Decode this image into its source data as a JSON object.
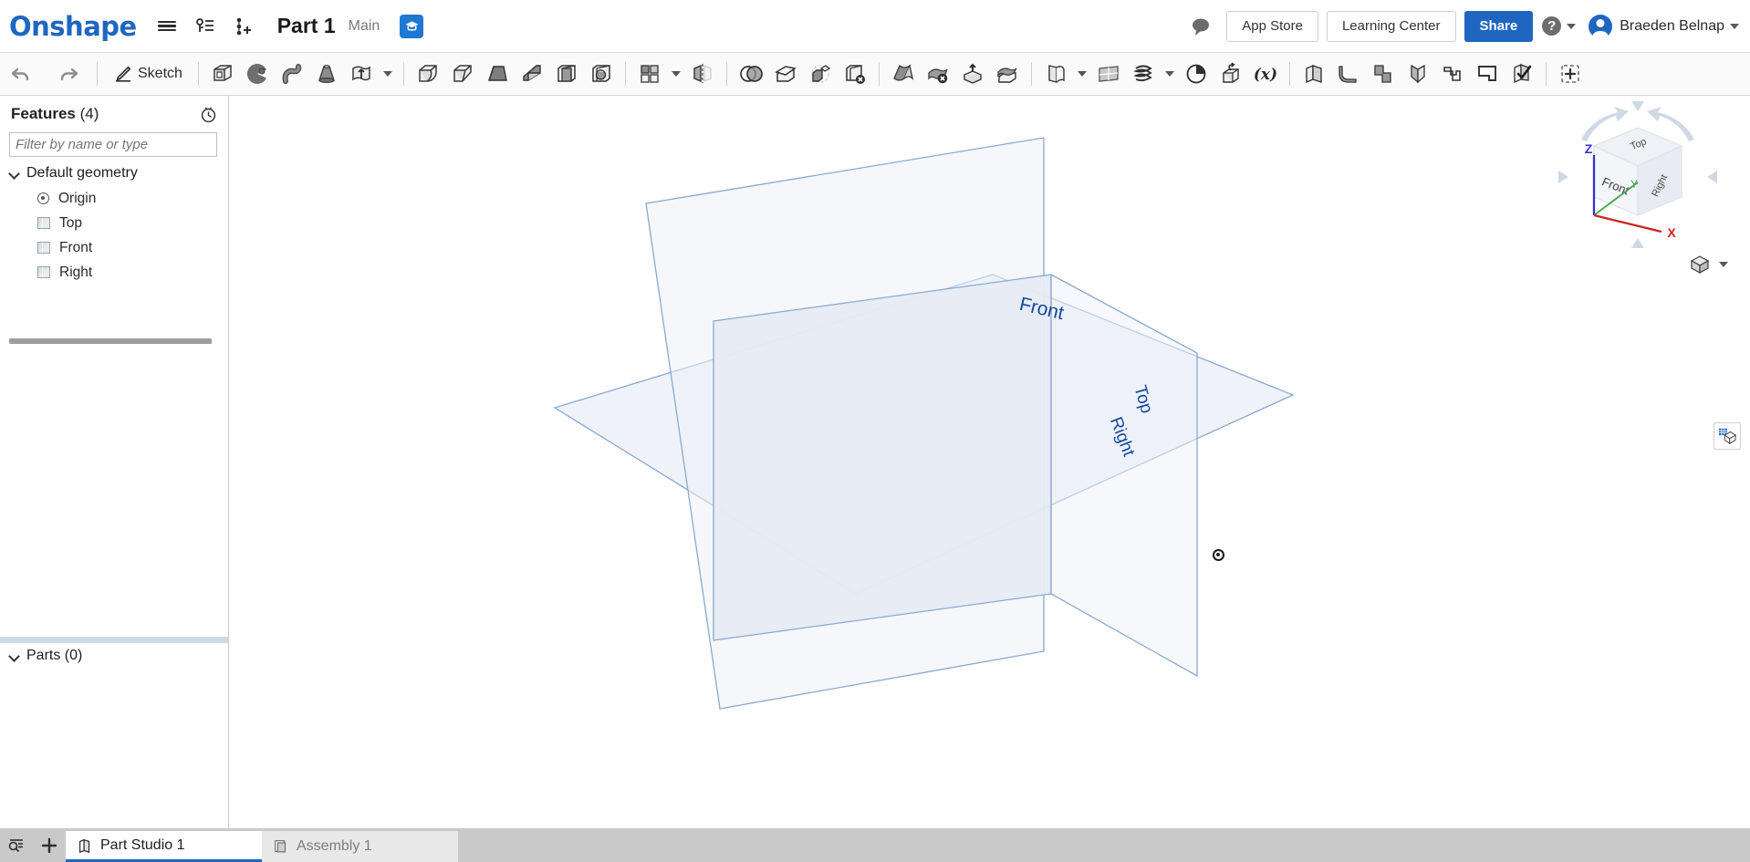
{
  "app": {
    "name": "Onshape",
    "brand_color": "#1f66c1"
  },
  "header": {
    "logo_text": "Onshape",
    "menu_icon": "hamburger-menu-icon",
    "versions_icon": "version-graph-icon",
    "insert_icon": "add-version-icon",
    "document_title": "Part 1",
    "branch": "Main",
    "workspace_badge_icon": "graduation-cap-icon",
    "comment_icon": "comment-bubble-icon",
    "app_store_label": "App Store",
    "learning_center_label": "Learning Center",
    "share_label": "Share",
    "help_label": "?",
    "user_name": "Braeden Belnap"
  },
  "toolbar": {
    "undo_icon": "undo-arrow-icon",
    "redo_icon": "redo-arrow-icon",
    "sketch_label": "Sketch",
    "sketch_icon": "sketch-pencil-icon",
    "items": [
      {
        "name": "extrude",
        "icon": "extrude-icon"
      },
      {
        "name": "revolve",
        "icon": "revolve-icon"
      },
      {
        "name": "sweep",
        "icon": "sweep-icon"
      },
      {
        "name": "loft",
        "icon": "loft-icon"
      },
      {
        "name": "thicken",
        "icon": "thicken-icon"
      },
      {
        "name": "fillet",
        "icon": "fillet-icon"
      },
      {
        "name": "chamfer",
        "icon": "chamfer-icon"
      },
      {
        "name": "draft",
        "icon": "draft-icon"
      },
      {
        "name": "rib",
        "icon": "rib-icon"
      },
      {
        "name": "shell",
        "icon": "shell-icon"
      },
      {
        "name": "hole",
        "icon": "hole-icon"
      },
      {
        "name": "linear-pattern",
        "icon": "pattern-grid-icon"
      },
      {
        "name": "mirror",
        "icon": "mirror-icon"
      },
      {
        "name": "boolean",
        "icon": "boolean-union-icon"
      },
      {
        "name": "split",
        "icon": "split-icon"
      },
      {
        "name": "transform",
        "icon": "transform-icon"
      },
      {
        "name": "delete-part",
        "icon": "delete-part-icon"
      },
      {
        "name": "sheet-metal-flange",
        "icon": "sheet-metal-flange-icon"
      },
      {
        "name": "delete-face",
        "icon": "delete-face-icon"
      },
      {
        "name": "move-face",
        "icon": "move-face-icon"
      },
      {
        "name": "replace-face",
        "icon": "replace-face-icon"
      },
      {
        "name": "plane",
        "icon": "construction-plane-icon"
      },
      {
        "name": "sketch-plane",
        "icon": "plane-grid-icon"
      },
      {
        "name": "helix",
        "icon": "helix-icon"
      },
      {
        "name": "mate-connector",
        "icon": "mate-connector-icon"
      },
      {
        "name": "derived",
        "icon": "derived-part-icon"
      },
      {
        "name": "variable",
        "icon": "variable-x-icon"
      },
      {
        "name": "sheet-metal-model",
        "icon": "sheet-metal-model-icon"
      },
      {
        "name": "sm-bend",
        "icon": "sm-bend-icon"
      },
      {
        "name": "sm-tab",
        "icon": "sm-tab-icon"
      },
      {
        "name": "sm-joint",
        "icon": "sm-joint-icon"
      },
      {
        "name": "sm-hem",
        "icon": "sm-hem-icon"
      },
      {
        "name": "sm-corner",
        "icon": "sm-corner-icon"
      },
      {
        "name": "sm-finish",
        "icon": "sm-finish-icon"
      },
      {
        "name": "custom-feature",
        "icon": "add-custom-feature-icon"
      }
    ]
  },
  "left_panel": {
    "features_label": "Features",
    "features_count": "(4)",
    "history_icon": "history-clock-icon",
    "filter_placeholder": "Filter by name or type",
    "filter_value": "",
    "default_geometry_label": "Default geometry",
    "tree_items": [
      {
        "label": "Origin",
        "icon": "origin-point-icon"
      },
      {
        "label": "Top",
        "icon": "plane-icon"
      },
      {
        "label": "Front",
        "icon": "plane-icon"
      },
      {
        "label": "Right",
        "icon": "plane-icon"
      }
    ],
    "parts_label": "Parts",
    "parts_count": "(0)"
  },
  "viewport": {
    "plane_labels": [
      {
        "name": "Front",
        "text": "Front"
      },
      {
        "name": "Top",
        "text": "Top"
      },
      {
        "name": "Right",
        "text": "Right"
      }
    ],
    "origin_marker_icon": "origin-point-marker",
    "plane_fill": "#eaeff6",
    "plane_stroke": "#8aa9d0",
    "label_color": "#14479e",
    "background": "#ffffff"
  },
  "viewcube": {
    "faces": {
      "top": "Top",
      "front": "Front",
      "right": "Right"
    },
    "axes": [
      {
        "label": "Z",
        "color": "#3a2fd6"
      },
      {
        "label": "Y",
        "color": "#3fa64a"
      },
      {
        "label": "X",
        "color": "#d02020"
      }
    ],
    "view_menu_icon": "cube-view-icon",
    "view_menu_caret": "chevron-down-icon"
  },
  "right_rail": {
    "appearance_icon": "appearance-panel-icon"
  },
  "tabbar": {
    "filter_icon": "tab-filter-icon",
    "add_icon": "add-tab-icon",
    "tabs": [
      {
        "label": "Part Studio 1",
        "icon": "part-studio-icon",
        "active": true
      },
      {
        "label": "Assembly 1",
        "icon": "assembly-icon",
        "active": false
      }
    ]
  }
}
